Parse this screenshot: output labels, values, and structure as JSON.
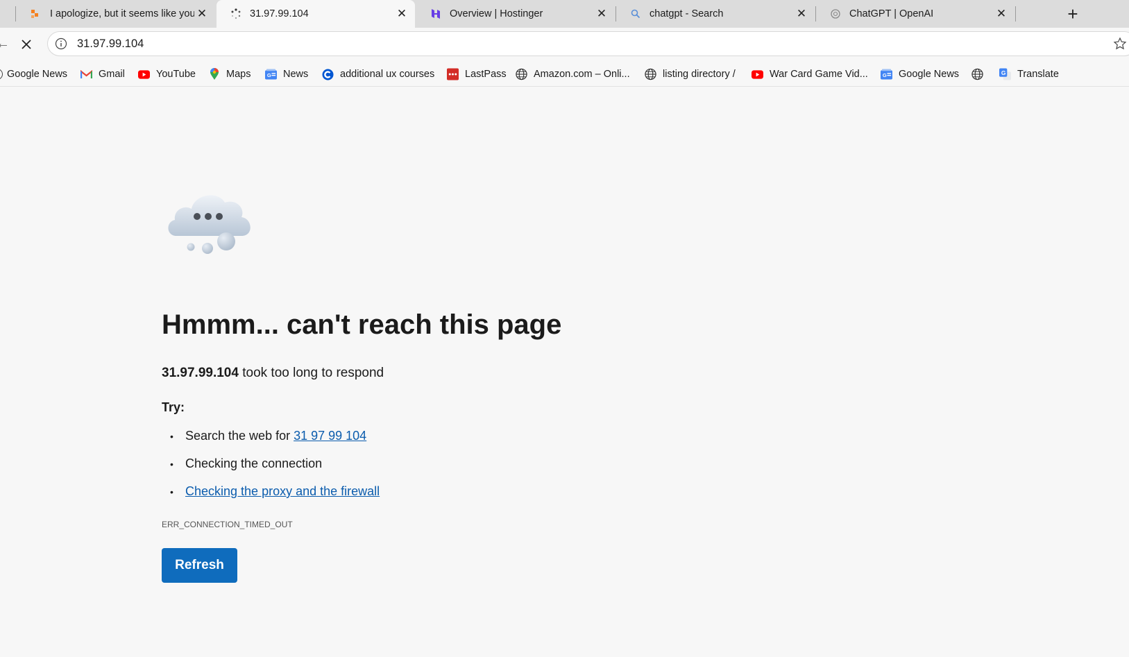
{
  "tabs": [
    {
      "title": "I apologize, but it seems like your",
      "icon": "tab-ai-icon",
      "active": false
    },
    {
      "title": "31.97.99.104",
      "icon": "loading-spinner-icon",
      "active": true
    },
    {
      "title": "Overview | Hostinger",
      "icon": "hostinger-icon",
      "active": false
    },
    {
      "title": "chatgpt - Search",
      "icon": "search-icon",
      "active": false
    },
    {
      "title": "ChatGPT | OpenAI",
      "icon": "openai-icon",
      "active": false
    }
  ],
  "address": {
    "url": "31.97.99.104"
  },
  "favorites": [
    {
      "label": "Google News",
      "icon": "google-news-icon"
    },
    {
      "label": "Gmail",
      "icon": "gmail-icon"
    },
    {
      "label": "YouTube",
      "icon": "youtube-icon"
    },
    {
      "label": "Maps",
      "icon": "maps-icon"
    },
    {
      "label": "News",
      "icon": "google-news-icon"
    },
    {
      "label": "additional ux courses",
      "icon": "coursera-icon"
    },
    {
      "label": "LastPass",
      "icon": "lastpass-icon"
    },
    {
      "label": "Amazon.com – Onli...",
      "icon": "globe-icon"
    },
    {
      "label": "listing directory /",
      "icon": "globe-icon"
    },
    {
      "label": "War Card Game Vid...",
      "icon": "youtube-icon"
    },
    {
      "label": "Google News",
      "icon": "google-news-icon"
    },
    {
      "label": "",
      "icon": "globe-icon"
    },
    {
      "label": "Translate",
      "icon": "google-translate-icon"
    }
  ],
  "error": {
    "title": "Hmmm... can't reach this page",
    "host": "31.97.99.104",
    "message": " took too long to respond",
    "try_label": "Try:",
    "suggestion1_prefix": "Search the web for ",
    "suggestion1_link": "31 97 99 104",
    "suggestion2": "Checking the connection",
    "suggestion3_link": "Checking the proxy and the firewall",
    "code": "ERR_CONNECTION_TIMED_OUT",
    "refresh_label": "Refresh"
  },
  "colors": {
    "link": "#0b5cad",
    "refresh_button": "#0f6cbd",
    "tabstrip_bg": "#dcdcdc",
    "page_bg": "#f7f7f7"
  }
}
